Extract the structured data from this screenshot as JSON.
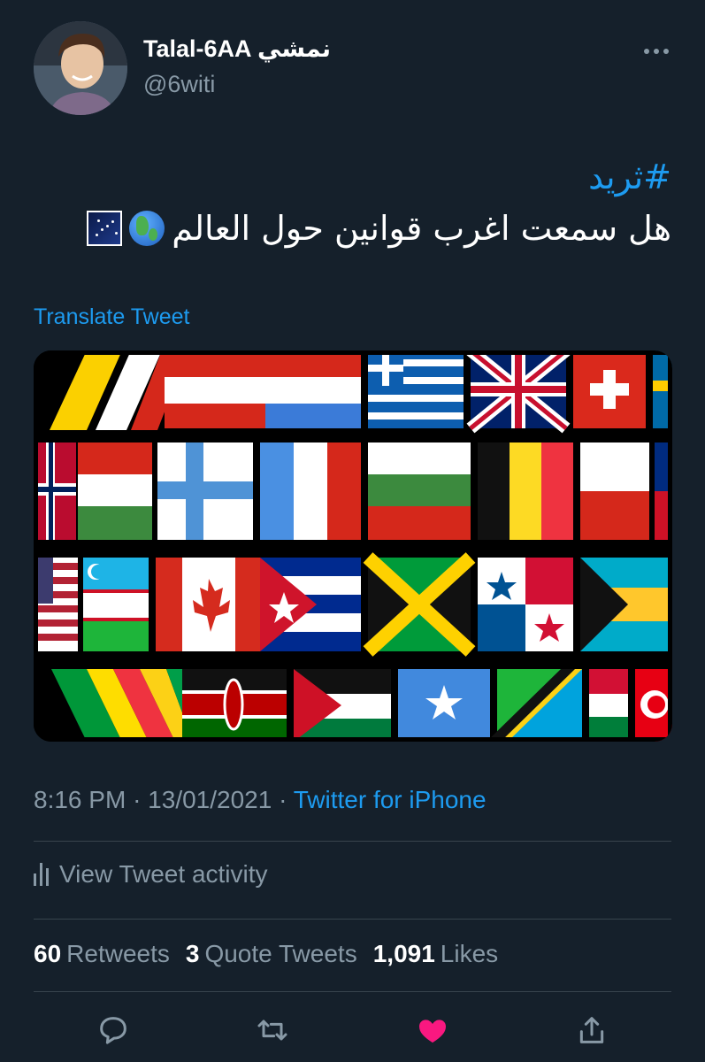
{
  "author": {
    "display_name": "Talal-6AA نمشي",
    "handle": "@6witi"
  },
  "tweet": {
    "hashtag": "#ثريد",
    "text": "هل سمعت اغرب قوانين حول العالم",
    "emoji": [
      "globe-americas",
      "milky-way"
    ],
    "translate_label": "Translate Tweet"
  },
  "meta": {
    "time": "8:16 PM",
    "date": "13/01/2021",
    "separator": "·",
    "source": "Twitter for iPhone"
  },
  "activity_label": "View Tweet activity",
  "stats": {
    "retweets_count": "60",
    "retweets_label": "Retweets",
    "quotes_count": "3",
    "quotes_label": "Quote Tweets",
    "likes_count": "1,091",
    "likes_label": "Likes"
  },
  "actions": [
    "reply-icon",
    "retweet-icon",
    "like-icon",
    "share-icon"
  ],
  "colors": {
    "background": "#15202b",
    "accent": "#1d9bf0",
    "secondary_text": "#8899a6",
    "like": "#f91880",
    "divider": "#38444d"
  }
}
